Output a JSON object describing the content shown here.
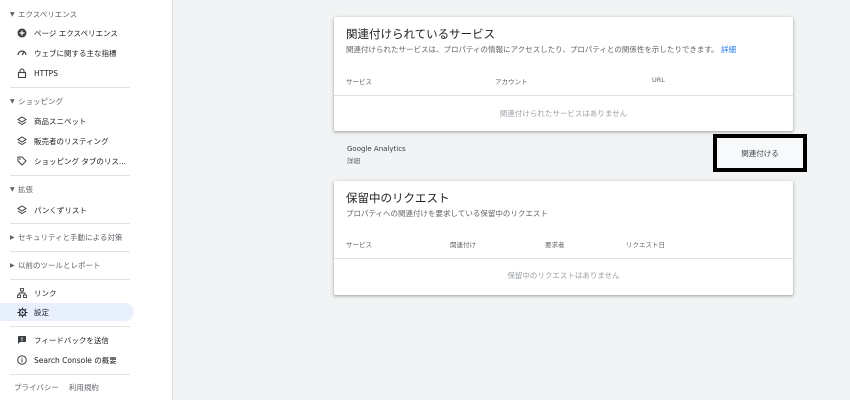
{
  "sidebar": {
    "experience_header": "エクスペリエンス",
    "experience_items": [
      {
        "label": "ページ エクスペリエンス",
        "icon": "plus-circle-icon"
      },
      {
        "label": "ウェブに関する主な指標",
        "icon": "speedometer-icon"
      },
      {
        "label": "HTTPS",
        "icon": "lock-icon"
      }
    ],
    "shopping_header": "ショッピング",
    "shopping_items": [
      {
        "label": "商品スニペット",
        "icon": "diamond-icon"
      },
      {
        "label": "販売者のリスティング",
        "icon": "diamond-icon"
      },
      {
        "label": "ショッピング タブのリス...",
        "icon": "tag-icon"
      }
    ],
    "enhancements_header": "拡張",
    "enhancements_items": [
      {
        "label": "パンくずリスト",
        "icon": "diamond-icon"
      }
    ],
    "security_header": "セキュリティと手動による対策",
    "legacy_header": "以前のツールとレポート",
    "links_label": "リンク",
    "settings_label": "設定",
    "feedback_label": "フィードバックを送信",
    "about_label": "Search Console の概要",
    "footer_privacy": "プライバシー",
    "footer_terms": "利用規約"
  },
  "associated": {
    "title": "関連付けられているサービス",
    "desc": "関連付けられたサービスは、プロパティの情報にアクセスしたり、プロパティとの関係性を示したりできます。",
    "desc_link": "詳細",
    "col_service": "サービス",
    "col_account": "アカウント",
    "col_url": "URL",
    "empty": "関連付けられたサービスはありません"
  },
  "ga": {
    "name": "Google Analytics",
    "sub": "詳細",
    "button": "関連付ける"
  },
  "pending": {
    "title": "保留中のリクエスト",
    "desc": "プロパティへの関連付けを要求している保留中のリクエスト",
    "col_service": "サービス",
    "col_link": "関連付け",
    "col_requester": "要求者",
    "col_date": "リクエスト日",
    "empty": "保留中のリクエストはありません"
  },
  "colors": {
    "accent": "#1a73e8",
    "active_bg": "#e8f0fe",
    "main_bg": "#f1f3f4"
  }
}
